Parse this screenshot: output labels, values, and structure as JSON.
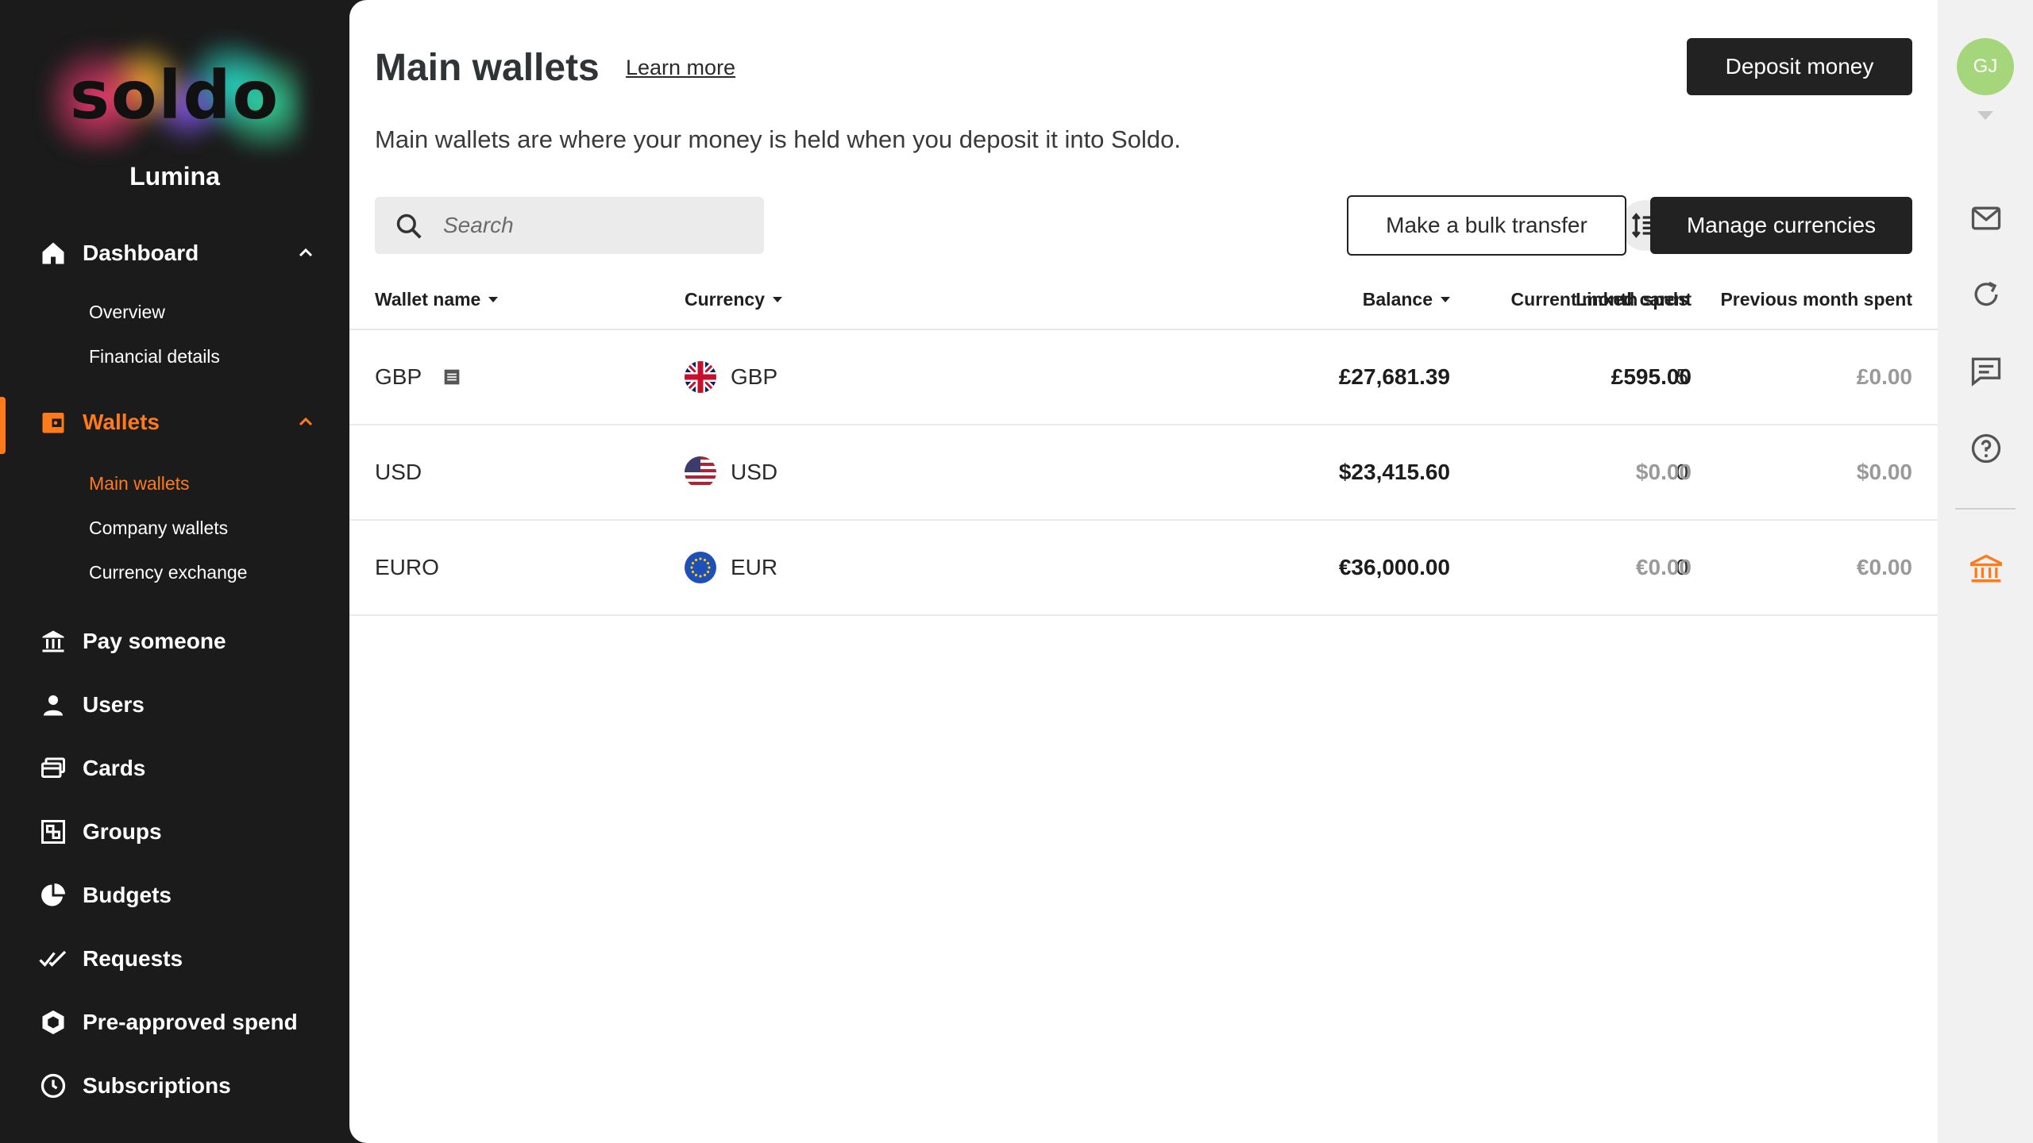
{
  "brand": {
    "logo": "soldo",
    "org": "Lumina"
  },
  "sidebar": {
    "dashboard": {
      "label": "Dashboard",
      "icon": "home-icon",
      "subitems": [
        "Overview",
        "Financial details"
      ]
    },
    "wallets": {
      "label": "Wallets",
      "icon": "wallet-icon",
      "subitems": [
        "Main wallets",
        "Company wallets",
        "Currency exchange"
      ],
      "active_sub": "Main wallets"
    },
    "items": [
      {
        "label": "Pay someone",
        "icon": "bank-transfer-icon"
      },
      {
        "label": "Users",
        "icon": "user-icon"
      },
      {
        "label": "Cards",
        "icon": "cards-icon"
      },
      {
        "label": "Groups",
        "icon": "groups-icon"
      },
      {
        "label": "Budgets",
        "icon": "pie-chart-icon"
      },
      {
        "label": "Requests",
        "icon": "double-check-icon"
      },
      {
        "label": "Pre-approved spend",
        "icon": "hexagon-icon"
      },
      {
        "label": "Subscriptions",
        "icon": "clock-icon"
      }
    ]
  },
  "header": {
    "title": "Main wallets",
    "learn_more": "Learn more",
    "deposit_label": "Deposit money",
    "description": "Main wallets are where your money is held when you deposit it into Soldo."
  },
  "toolbar": {
    "search_placeholder": "Search",
    "bulk_transfer_label": "Make a bulk transfer",
    "manage_currencies_label": "Manage currencies"
  },
  "table": {
    "columns": [
      "Wallet name",
      "Currency",
      "Balance",
      "Linked cards",
      "Current month spent",
      "Previous month spent"
    ],
    "rows": [
      {
        "name": "GBP",
        "currency": "GBP",
        "flag": "uk-flag-icon",
        "balance": "£27,681.39",
        "linked_cards": "5",
        "current_spent": "£595.00",
        "previous_spent": "£0.00"
      },
      {
        "name": "USD",
        "currency": "USD",
        "flag": "us-flag-icon",
        "balance": "$23,415.60",
        "linked_cards": "0",
        "current_spent": "$0.00",
        "previous_spent": "$0.00"
      },
      {
        "name": "EURO",
        "currency": "EUR",
        "flag": "eu-flag-icon",
        "balance": "€36,000.00",
        "linked_cards": "0",
        "current_spent": "€0.00",
        "previous_spent": "€0.00"
      }
    ]
  },
  "rail": {
    "avatar_initials": "GJ"
  },
  "colors": {
    "accent": "#ff7a1a",
    "sidebar_bg": "#1b1b1b",
    "avatar": "#a6d67b",
    "button_dark": "#222222"
  }
}
